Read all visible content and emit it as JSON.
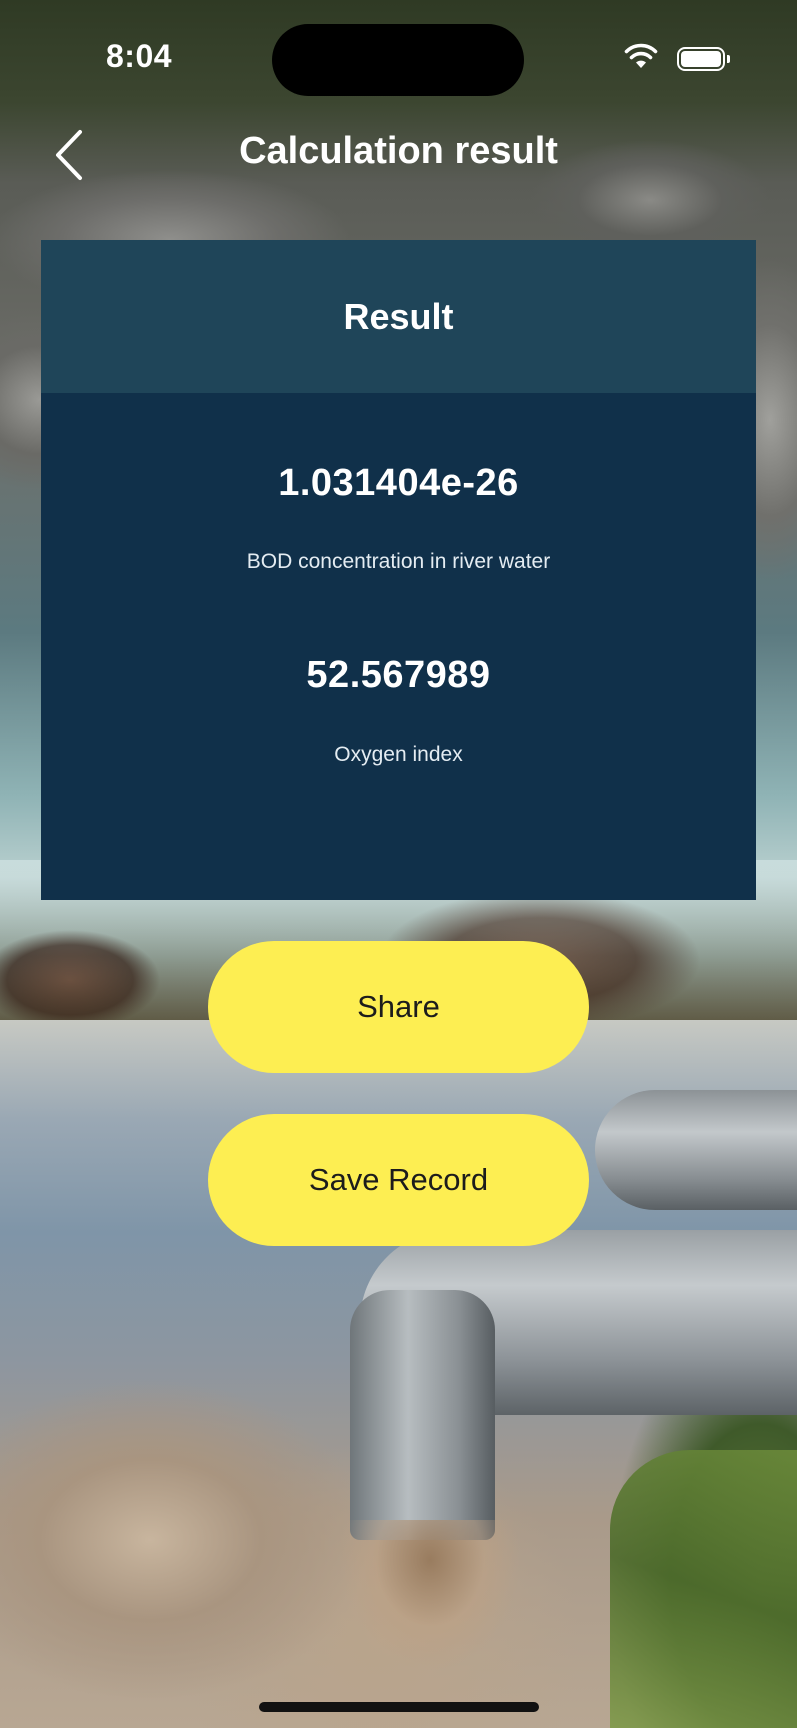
{
  "status_bar": {
    "time": "8:04",
    "icons": [
      "wifi-icon",
      "battery-icon"
    ]
  },
  "nav": {
    "title": "Calculation result",
    "back_icon": "chevron-left-icon"
  },
  "card": {
    "header": "Result",
    "results": [
      {
        "value": "1.031404e-26",
        "label": "BOD concentration in river water"
      },
      {
        "value": "52.567989",
        "label": "Oxygen index"
      }
    ]
  },
  "actions": {
    "share_label": "Share",
    "save_label": "Save Record"
  },
  "colors": {
    "card_header": "#1f4559",
    "card_body": "#10304a",
    "button": "#fdee52",
    "text_on_card": "#ffffff"
  }
}
